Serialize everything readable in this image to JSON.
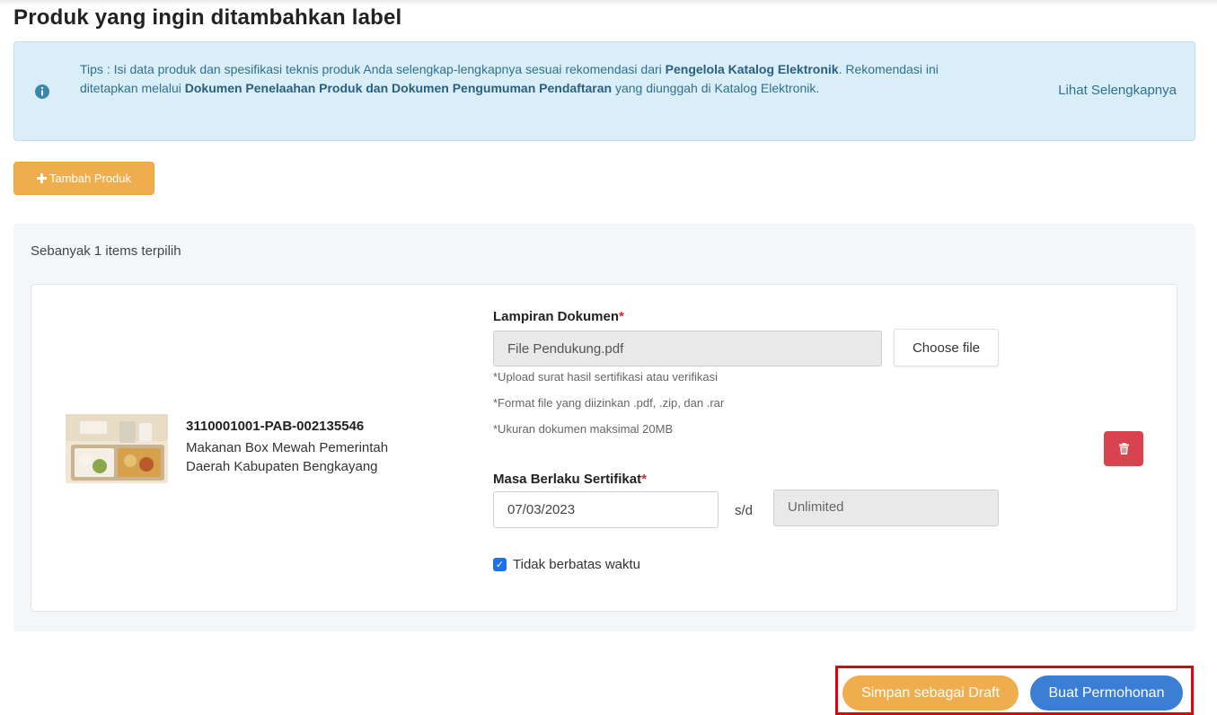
{
  "page": {
    "title": "Produk yang ingin ditambahkan label"
  },
  "tips": {
    "prefix": "Tips : Isi data produk dan spesifikasi teknis produk Anda selengkap-lengkapnya sesuai rekomendasi dari ",
    "bold1": "Pengelola Katalog Elektronik",
    "middle": ". Rekomendasi ini ditetapkan melalui ",
    "bold2": "Dokumen Penelaahan Produk dan Dokumen Pengumuman Pendaftaran",
    "suffix": " yang diunggah di Katalog Elektronik.",
    "more_link": "Lihat Selengkapnya",
    "icon": "info-circle-icon"
  },
  "toolbar": {
    "add_product_label": "Tambah Produk",
    "add_icon": "plus-icon"
  },
  "selection": {
    "count_text": "Sebanyak 1 items terpilih"
  },
  "product": {
    "code": "3110001001-PAB-002135546",
    "name": "Makanan Box Mewah Pemerintah Daerah Kabupaten Bengkayang"
  },
  "form": {
    "attachment_label": "Lampiran Dokumen",
    "required_mark": "*",
    "file_value": "File Pendukung.pdf",
    "choose_file_label": "Choose file",
    "hints": [
      "*Upload surat hasil sertifikasi atau verifikasi",
      "*Format file yang diizinkan .pdf, .zip, dan .rar",
      "*Ukuran dokumen maksimal 20MB"
    ],
    "validity_label": "Masa Berlaku Sertifikat",
    "start_date": "07/03/2023",
    "separator": "s/d",
    "end_date": "Unlimited",
    "no_limit_label": "Tidak berbatas waktu",
    "no_limit_checked": true
  },
  "actions": {
    "draft_label": "Simpan sebagai Draft",
    "submit_label": "Buat Permohonan"
  },
  "colors": {
    "warning": "#f0ad4e",
    "primary": "#3a7fd5",
    "danger": "#d9434f",
    "info_bg": "#d9eef7",
    "highlight": "#e3000f"
  }
}
